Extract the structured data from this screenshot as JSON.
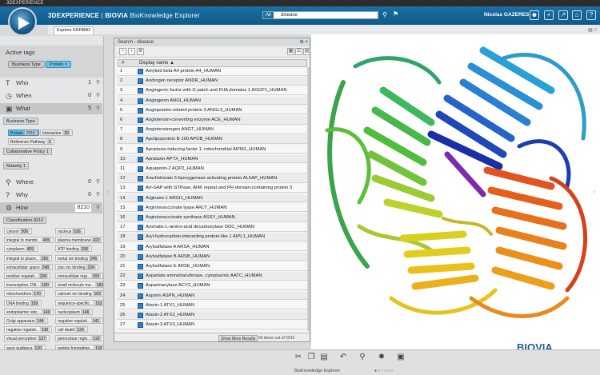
{
  "window": {
    "title": "3DEXPERIENCE"
  },
  "header": {
    "brand_prefix": "3DEXPERIENCE",
    "brand_sep": " | ",
    "brand_company": "BIOVIA",
    "app_name": " BioKnowledge Explorer",
    "search_scope": "All",
    "search_query": "disease",
    "user_name": "Nicolas GAZERES"
  },
  "tab": {
    "label": "Explore ERRBB2"
  },
  "active_tags": {
    "title": "Active tags",
    "chips": [
      {
        "label": "Business Type",
        "highlight": false
      },
      {
        "label": "Protein ×",
        "highlight": true
      }
    ]
  },
  "dimensions": [
    {
      "label": "Who",
      "count": "1",
      "icon": "who-icon"
    },
    {
      "label": "When",
      "count": "0",
      "icon": "clock-icon"
    },
    {
      "label": "What",
      "count": "5",
      "icon": "cube-icon"
    },
    {
      "label": "Where",
      "count": "0",
      "icon": "location-icon"
    },
    {
      "label": "Why",
      "count": "0",
      "icon": "question-icon"
    },
    {
      "label": "How",
      "count": "8210",
      "icon": "how-icon"
    }
  ],
  "what_sub": {
    "business_type": "Business Type",
    "tags": [
      {
        "label": "Protein",
        "count": "2910"
      },
      {
        "label": "Interaction",
        "count": "20"
      },
      {
        "label": "Reference Pathway",
        "count": "2"
      }
    ],
    "collab": "Collaborative Policy",
    "collab_count": "1",
    "maturity": "Maturity",
    "maturity_count": "1"
  },
  "classification": {
    "label": "Classification",
    "count": "8210",
    "items": [
      {
        "label": "cytosol",
        "count": "506"
      },
      {
        "label": "nucleus",
        "count": "526"
      },
      {
        "label": "integral to membr...",
        "count": "495"
      },
      {
        "label": "plasma membrane",
        "count": "422"
      },
      {
        "label": "cytoplasm",
        "count": "409"
      },
      {
        "label": "ATP binding",
        "count": "336"
      },
      {
        "label": "integral to plasm...",
        "count": "265"
      },
      {
        "label": "metal ion binding",
        "count": "245"
      },
      {
        "label": "extracellular space",
        "count": "248"
      },
      {
        "label": "zinc ion binding",
        "count": "224"
      },
      {
        "label": "positive regulati...",
        "count": "206"
      },
      {
        "label": "extracellular regi...",
        "count": "203"
      },
      {
        "label": "transcription, DN...",
        "count": "180"
      },
      {
        "label": "small molecule me...",
        "count": "183"
      },
      {
        "label": "mitochondrion",
        "count": "170"
      },
      {
        "label": "calcium ion binding",
        "count": "163"
      },
      {
        "label": "DNA binding",
        "count": "159"
      },
      {
        "label": "sequence-specific...",
        "count": "152"
      },
      {
        "label": "endoplasmic retic...",
        "count": "149"
      },
      {
        "label": "nucleoplasm",
        "count": "146"
      },
      {
        "label": "Golgi apparatus",
        "count": "144"
      },
      {
        "label": "negative regulati...",
        "count": "141"
      },
      {
        "label": "negative regulati...",
        "count": "139"
      },
      {
        "label": "cell death",
        "count": "126"
      },
      {
        "label": "visual perception",
        "count": "127"
      },
      {
        "label": "perinuclear regio...",
        "count": "122"
      },
      {
        "label": "axon guidance",
        "count": "120"
      },
      {
        "label": "protein homodime...",
        "count": "118"
      }
    ]
  },
  "results": {
    "title": "Search - disease",
    "col_index": "#",
    "col_name": "Display name ▲",
    "rows": [
      {
        "n": "1",
        "name": "Amyloid beta A4 protein A4_HUMAN"
      },
      {
        "n": "2",
        "name": "Androgen receptor ANDR_HUMAN"
      },
      {
        "n": "3",
        "name": "Angiogenic factor with G patch and FHA domains 1 AGGF1_HUMAN"
      },
      {
        "n": "4",
        "name": "Angiogenin ANGI_HUMAN"
      },
      {
        "n": "5",
        "name": "Angiopoietin-related protein 3 ANGL3_HUMAN"
      },
      {
        "n": "6",
        "name": "Angiotensin-converting enzyme ACE_HUMAN"
      },
      {
        "n": "7",
        "name": "Angiotensinogen ANGT_HUMAN"
      },
      {
        "n": "8",
        "name": "Apolipoprotein B-100 APOB_HUMAN"
      },
      {
        "n": "9",
        "name": "Apoptosis-inducing factor 1, mitochondrial AIFM1_HUMAN"
      },
      {
        "n": "10",
        "name": "Aprataxin APTX_HUMAN"
      },
      {
        "n": "11",
        "name": "Aquaporin-2 AQP2_HUMAN"
      },
      {
        "n": "12",
        "name": "Arachidonate 5-lipoxygenase-activating protein AL5AP_HUMAN"
      },
      {
        "n": "13",
        "name": "Arf-GAP with GTPase, ANK repeat and PH domain-containing protein 3"
      },
      {
        "n": "14",
        "name": "Arginase-1 ARGI1_HUMAN"
      },
      {
        "n": "15",
        "name": "Argininosuccinate lyase ARLY_HUMAN"
      },
      {
        "n": "16",
        "name": "Argininosuccinate synthase ASSY_HUMAN"
      },
      {
        "n": "17",
        "name": "Aromatic-L-amino-acid decarboxylase DDC_HUMAN"
      },
      {
        "n": "18",
        "name": "Aryl-hydrocarbon-interacting protein-like 1 AIPL1_HUMAN"
      },
      {
        "n": "19",
        "name": "Arylsulfatase A ARSA_HUMAN"
      },
      {
        "n": "20",
        "name": "Arylsulfatase B ARSB_HUMAN"
      },
      {
        "n": "21",
        "name": "Arylsulfatase E ARSE_HUMAN"
      },
      {
        "n": "22",
        "name": "Aspartate aminotransferase, cytoplasmic AATC_HUMAN"
      },
      {
        "n": "23",
        "name": "Aspartoacylase ACY2_HUMAN"
      },
      {
        "n": "24",
        "name": "Asporin ASPN_HUMAN"
      },
      {
        "n": "25",
        "name": "Ataxin-1 ATX1_HUMAN"
      },
      {
        "n": "26",
        "name": "Ataxin-2 ATX2_HUMAN"
      },
      {
        "n": "27",
        "name": "Ataxin-3 ATX3_HUMAN"
      }
    ],
    "show_more": "Show More Results",
    "count_label": "50 items out of 2910"
  },
  "footer": {
    "caption": "BioKnowledge Explorer",
    "dots": "●○○○○○",
    "logo": "BIOVIA"
  }
}
